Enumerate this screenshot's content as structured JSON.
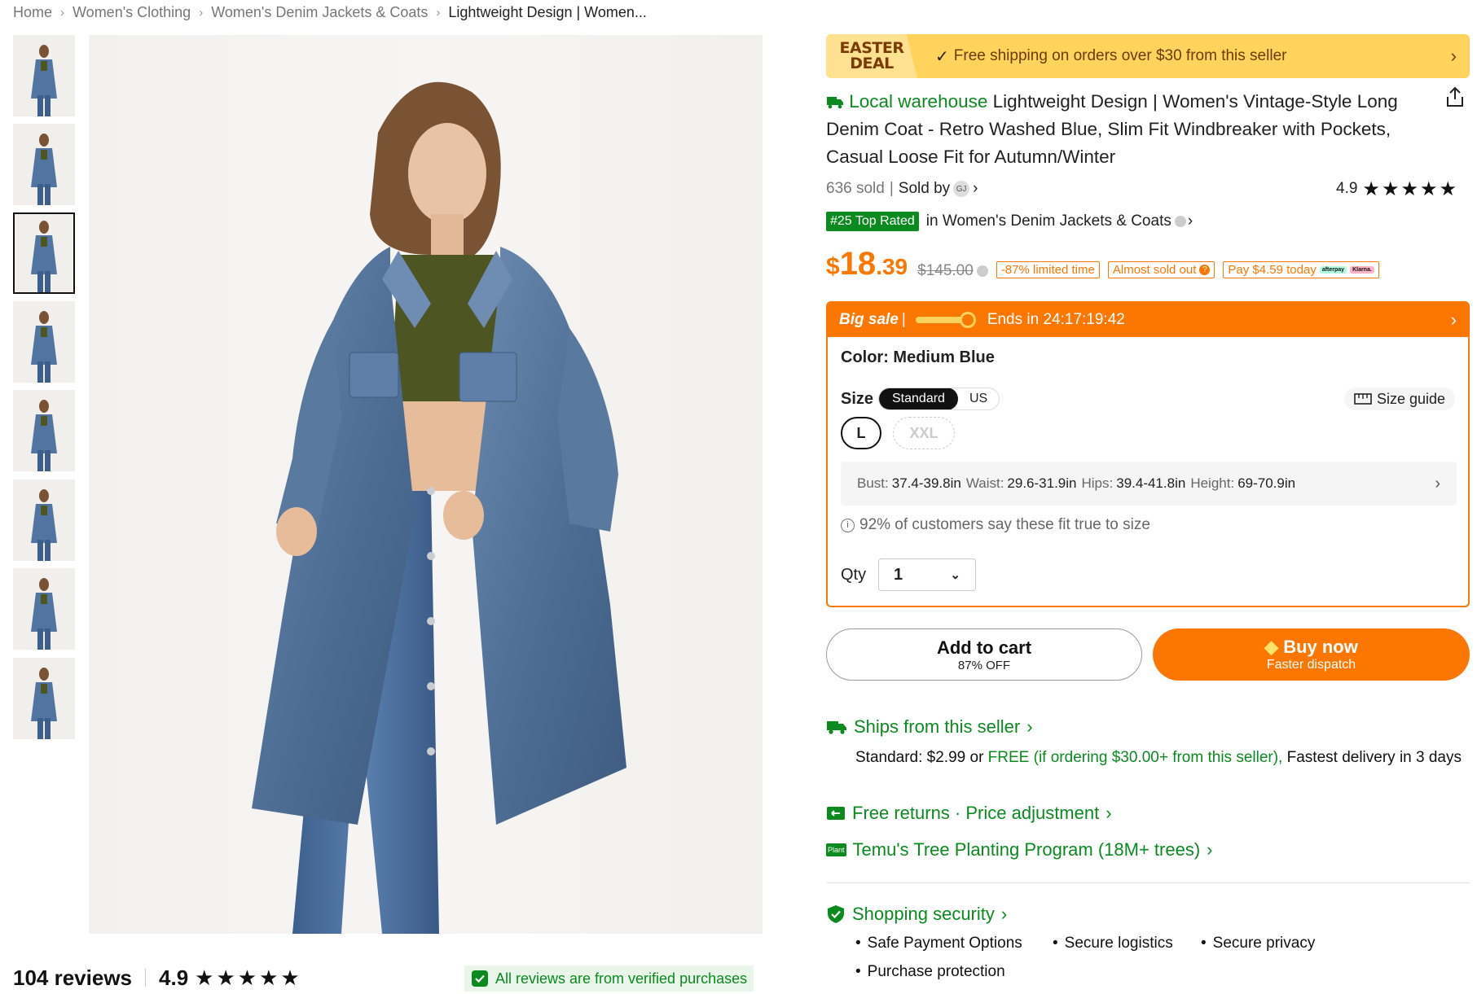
{
  "breadcrumb": [
    "Home",
    "Women's Clothing",
    "Women's Denim Jackets & Coats",
    "Lightweight Design | Women..."
  ],
  "reviews": {
    "count_label": "104 reviews",
    "rating": "4.9",
    "verified": "All reviews are from verified purchases"
  },
  "deal": {
    "logo_line1": "EASTER",
    "logo_line2": "DEAL",
    "text": "Free shipping on orders over $30 from this seller"
  },
  "product": {
    "badge": "Local warehouse",
    "title": "Lightweight Design | Women's Vintage-Style Long Denim Coat - Retro Washed Blue, Slim Fit Windbreaker with Pockets, Casual Loose Fit for Autumn/Winter",
    "sold": "636 sold",
    "sold_by": "Sold by",
    "seller_initials": "GJ",
    "rating": "4.9",
    "top_rated": "#25 Top Rated",
    "category": "in Women's Denim Jackets & Coats"
  },
  "price": {
    "currency": "$",
    "whole": "18",
    "cents": ".39",
    "original": "$145.00",
    "tags": [
      "-87% limited time",
      "Almost sold out",
      "Pay $4.59 today"
    ],
    "pay_logos": [
      "afterpay",
      "Klarna."
    ]
  },
  "sale": {
    "label": "Big sale",
    "sep": "|",
    "countdown": "Ends in 24:17:19:42",
    "color_label": "Color: Medium Blue",
    "size_label": "Size",
    "size_system": [
      "Standard",
      "US"
    ],
    "size_guide": "Size guide",
    "sizes": [
      "L",
      "XXL"
    ],
    "measurements": [
      {
        "k": "Bust:",
        "v": "37.4-39.8in"
      },
      {
        "k": "Waist:",
        "v": "29.6-31.9in"
      },
      {
        "k": "Hips:",
        "v": "39.4-41.8in"
      },
      {
        "k": "Height:",
        "v": "69-70.9in"
      }
    ],
    "fit_note": "92% of customers say these fit true to size",
    "qty_label": "Qty",
    "qty_value": "1"
  },
  "actions": {
    "add_cart": "Add to cart",
    "add_cart_sub": "87% OFF",
    "buy_now": "Buy now",
    "buy_now_sub": "Faster dispatch"
  },
  "services": {
    "ships": "Ships from this seller",
    "shipping_std": "Standard: $2.99 or",
    "shipping_free": "FREE (if ordering $30.00+ from this seller),",
    "shipping_fast": "Fastest delivery in 3 days",
    "returns": "Free returns · Price adjustment",
    "plant_icon_text": "Plant",
    "tree": "Temu's Tree Planting Program (18M+ trees)",
    "security": "Shopping security",
    "security_items": [
      "Safe Payment Options",
      "Secure logistics",
      "Secure privacy",
      "Purchase protection"
    ]
  },
  "colors": {
    "accent": "#fb7701",
    "green": "#0a8a1f",
    "deal_bg": "#ffd35c",
    "denim": "#4f6f96"
  }
}
